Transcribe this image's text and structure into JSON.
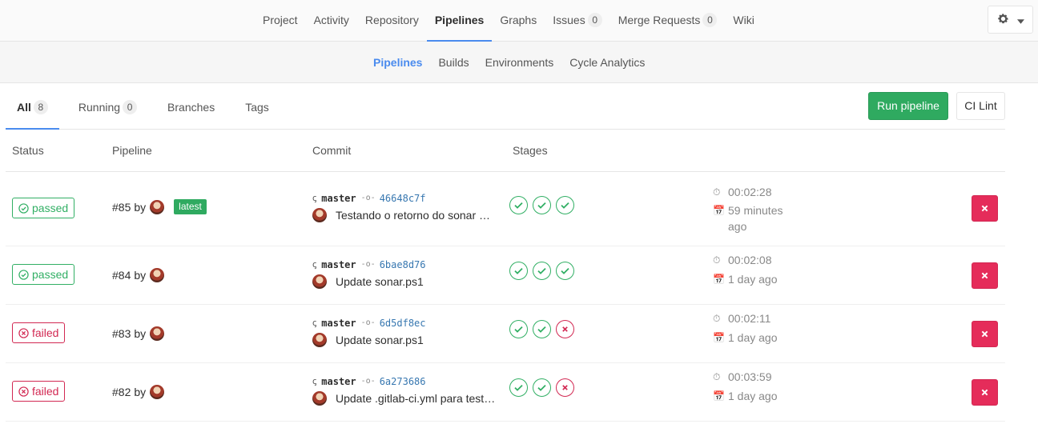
{
  "topnav": {
    "items": [
      {
        "label": "Project"
      },
      {
        "label": "Activity"
      },
      {
        "label": "Repository"
      },
      {
        "label": "Pipelines"
      },
      {
        "label": "Graphs"
      },
      {
        "label": "Issues",
        "count": "0"
      },
      {
        "label": "Merge Requests",
        "count": "0"
      },
      {
        "label": "Wiki"
      }
    ],
    "active": "Pipelines",
    "settings_icon": "gear-icon"
  },
  "subnav": {
    "items": [
      {
        "label": "Pipelines"
      },
      {
        "label": "Builds"
      },
      {
        "label": "Environments"
      },
      {
        "label": "Cycle Analytics"
      }
    ],
    "active": "Pipelines"
  },
  "scope": {
    "tabs": [
      {
        "label": "All",
        "count": "8"
      },
      {
        "label": "Running",
        "count": "0"
      },
      {
        "label": "Branches"
      },
      {
        "label": "Tags"
      }
    ],
    "run_pipeline_label": "Run pipeline",
    "ci_lint_label": "CI Lint"
  },
  "table": {
    "headers": {
      "status": "Status",
      "pipeline": "Pipeline",
      "commit": "Commit",
      "stages": "Stages"
    },
    "rows": [
      {
        "status": "passed",
        "pipeline_id": "#85",
        "by": "by",
        "latest": "latest",
        "branch": "master",
        "sha": "46648c7f",
        "commit_title": "Testando o retorno do sonar …",
        "stages": [
          "success",
          "success",
          "success"
        ],
        "duration": "00:02:28",
        "finished": "59 minutes ago"
      },
      {
        "status": "passed",
        "pipeline_id": "#84",
        "by": "by",
        "branch": "master",
        "sha": "6bae8d76",
        "commit_title": "Update sonar.ps1",
        "stages": [
          "success",
          "success",
          "success"
        ],
        "duration": "00:02:08",
        "finished": "1 day ago"
      },
      {
        "status": "failed",
        "pipeline_id": "#83",
        "by": "by",
        "branch": "master",
        "sha": "6d5df8ec",
        "commit_title": "Update sonar.ps1",
        "stages": [
          "success",
          "success",
          "failed"
        ],
        "duration": "00:02:11",
        "finished": "1 day ago"
      },
      {
        "status": "failed",
        "pipeline_id": "#82",
        "by": "by",
        "branch": "master",
        "sha": "6a273686",
        "commit_title": "Update .gitlab-ci.yml para test…",
        "stages": [
          "success",
          "success",
          "failed"
        ],
        "duration": "00:03:59",
        "finished": "1 day ago"
      }
    ]
  },
  "colors": {
    "success": "#31af64",
    "failed": "#d22852",
    "accent": "#4a8bee",
    "run_button": "#2faa60",
    "cancel_button": "#e52c5a"
  }
}
